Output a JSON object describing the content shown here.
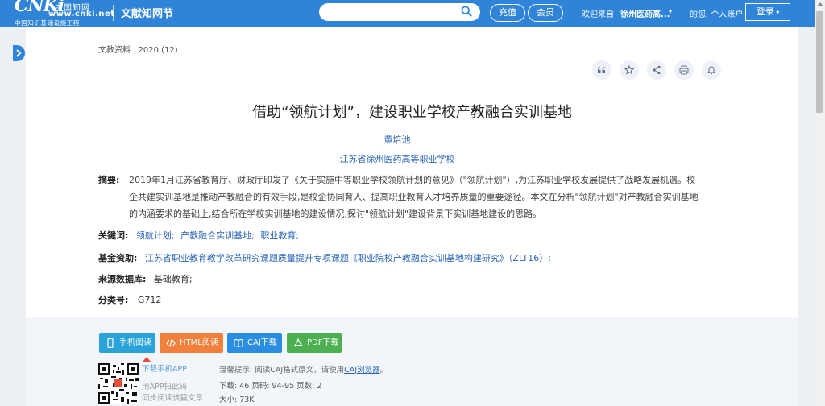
{
  "header": {
    "logo_cn": "中国知网",
    "logo_url": "www.cnki.net",
    "logo_sub": "中国知识基础设施工程",
    "section_title": "文献知网节",
    "recharge": "充值",
    "member": "会员",
    "welcome_prefix": "欢迎来自",
    "org_name": "徐州医药高...",
    "welcome_suffix": "的您, 个人账户",
    "login": "登录"
  },
  "article": {
    "source": "文教资料 . 2020,(12)",
    "title": "借助“领航计划”，建设职业学校产教融合实训基地",
    "author": "黄培池",
    "organization": "江苏省徐州医药高等职业学校",
    "abstract_label": "摘要:",
    "abstract_lines": [
      "2019年1月江苏省教育厅、财政厅印发了《关于实施中等职业学校领航计划的意见》（\"领航计划\"）,为江苏职业学校发展提供了战略发展机遇。校",
      "企共建实训基地是推动产教融合的有效手段,是校企协同育人、提高职业教育人才培养质量的重要途径。本文在分析\"领航计划\"对产教融合实训基地",
      "的内涵要求的基础上,结合所在学校实训基地的建设情况,探讨\"领航计划\"建设背景下实训基地建设的思路。"
    ],
    "keywords_label": "关键词:",
    "keywords": [
      "领航计划;",
      "产教融合实训基地;",
      "职业教育;"
    ],
    "fund_label": "基金资助:",
    "fund_text": "江苏省职业教育教学改革研究课题质量提升专项课题《职业院校产教融合实训基地构建研究》（ZLT16）;",
    "db_label": "来源数据库:",
    "db_text": "基础教育;",
    "class_label": "分类号:",
    "class_text": "G712"
  },
  "actions": {
    "mobile_read": "手机阅读",
    "html_read": "HTML阅读",
    "caj_download": "CAJ下载",
    "pdf_download": "PDF下载"
  },
  "app": {
    "download_app": "下载手机APP",
    "scan_line1": "用APP扫此码",
    "scan_line2": "同步阅读该篇文章"
  },
  "info": {
    "tip_prefix": "温馨提示:  阅读CAJ格式原文，请使用",
    "tip_link": "CAJ浏览器",
    "tip_suffix": "。",
    "stats": "下载:  46     页码:  94-95     页数:  2",
    "size": "大小:  73K"
  },
  "colors": {
    "header_blue": "#2f84d8",
    "link_blue": "#2d66b7",
    "mobile_btn": "#2aa3d8",
    "html_btn": "#f0803c",
    "caj_btn": "#2b8de0",
    "pdf_btn": "#4caf50"
  }
}
